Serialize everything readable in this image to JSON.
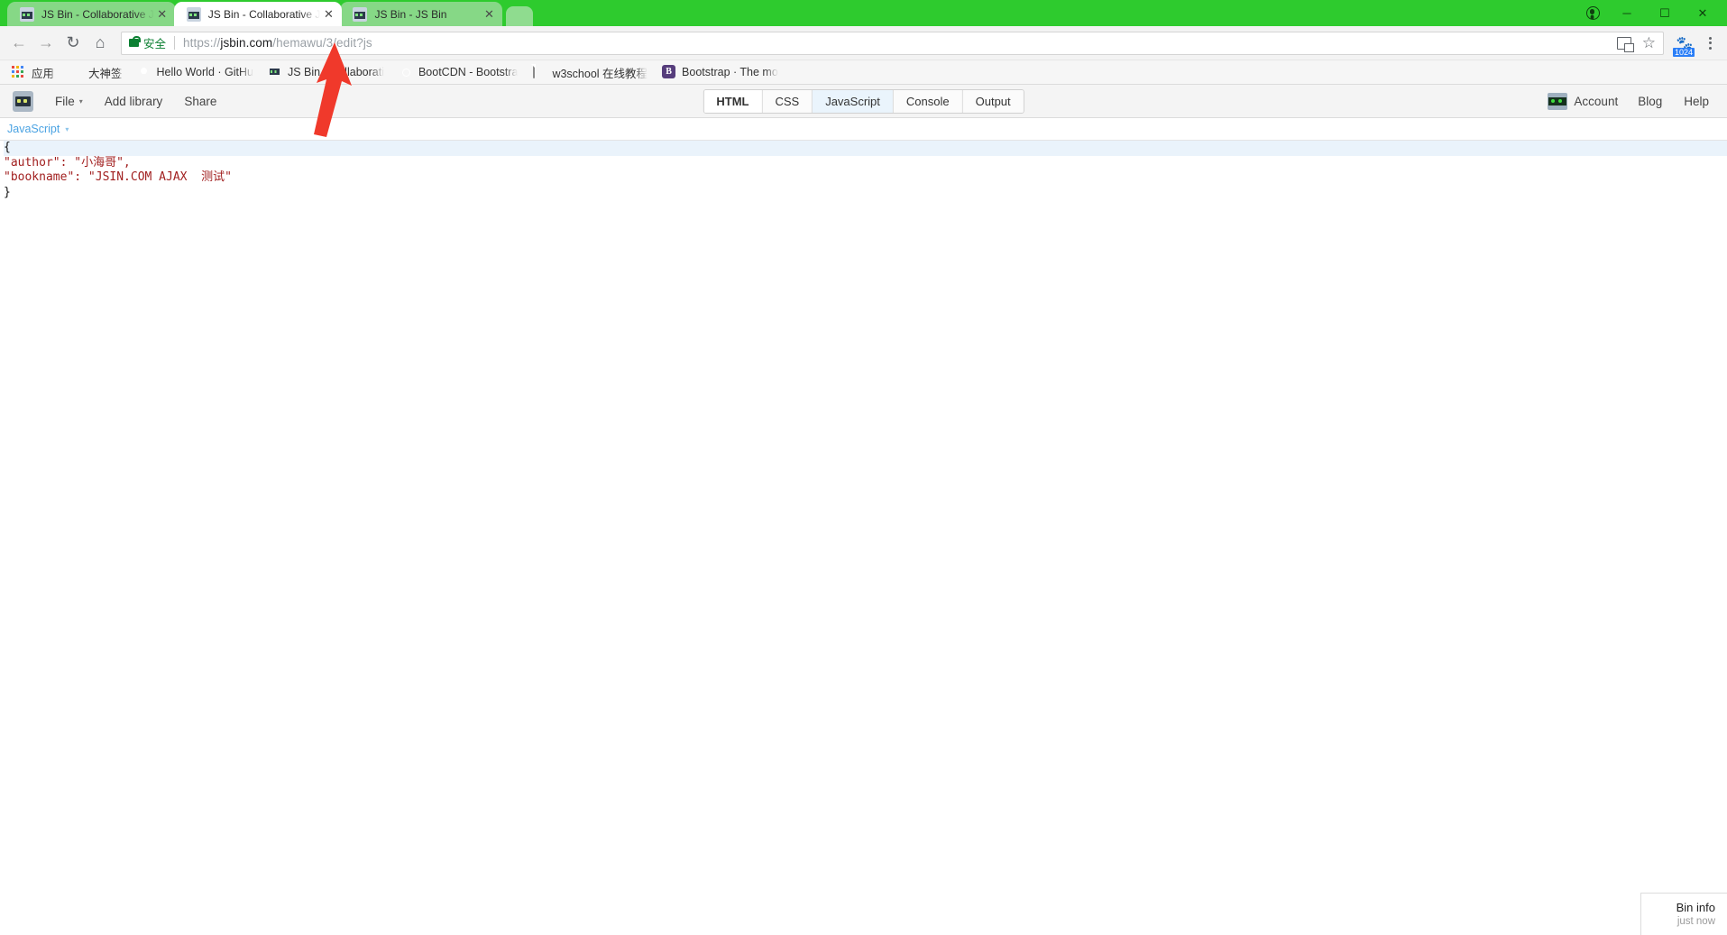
{
  "browser": {
    "tabs": [
      {
        "title": "JS Bin - Collaborative J",
        "active": false,
        "favicon": "jsbin-favicon"
      },
      {
        "title": "JS Bin - Collaborative J",
        "active": true,
        "favicon": "jsbin-favicon"
      },
      {
        "title": "JS Bin - JS Bin",
        "active": false,
        "favicon": "jsbin-favicon"
      }
    ],
    "window_controls": {
      "minimize": "—",
      "maximize": "❐",
      "close": "✕",
      "profile": "profile-icon"
    },
    "nav": {
      "back": "←",
      "forward": "→",
      "reload": "↻",
      "home": "⌂"
    },
    "omnibox": {
      "secure_label": "安全",
      "url_scheme": "https://",
      "url_host": "jsbin.com",
      "url_path": "/hemawu/3/edit?js",
      "url_full": "https://jsbin.com/hemawu/3/edit?js"
    },
    "omnibox_icons": {
      "translate": "translate-icon",
      "bookmark_star": "☆"
    },
    "extension": {
      "icon": "extension-icon",
      "badge": "1024"
    },
    "menu": "chrome-menu-icon",
    "bookmarks": [
      {
        "label": "应用",
        "icon": "apps-grid-icon"
      },
      {
        "label": "大神签",
        "icon": "folder-icon"
      },
      {
        "label": "Hello World · GitHu",
        "icon": "github-icon"
      },
      {
        "label": "JS Bin - Collaborati",
        "icon": "jsbin-icon"
      },
      {
        "label": "BootCDN - Bootstra",
        "icon": "bootcdn-icon"
      },
      {
        "label": "w3school 在线教程",
        "icon": "page-icon"
      },
      {
        "label": "Bootstrap · The mo",
        "icon": "bootstrap-icon"
      }
    ]
  },
  "jsbin": {
    "logo": "jsbin-logo-icon",
    "menu": [
      {
        "label": "File",
        "caret": "▾"
      },
      {
        "label": "Add library",
        "caret": ""
      },
      {
        "label": "Share",
        "caret": ""
      }
    ],
    "panel_tabs": [
      {
        "label": "HTML",
        "state": "bold"
      },
      {
        "label": "CSS",
        "state": "normal"
      },
      {
        "label": "JavaScript",
        "state": "selected"
      },
      {
        "label": "Console",
        "state": "normal"
      },
      {
        "label": "Output",
        "state": "normal"
      }
    ],
    "account": {
      "icon": "jsbin-account-icon",
      "label": "Account"
    },
    "right_links": [
      "Blog",
      "Help"
    ],
    "language_selector": {
      "label": "JavaScript",
      "caret": "▾"
    },
    "code_lines": [
      {
        "text": "{",
        "current": true
      },
      {
        "text": "\"author\": \"小海哥\",",
        "current": false
      },
      {
        "text": "\"bookname\": \"JSIN.COM AJAX  测试\"",
        "current": false
      },
      {
        "text": "}",
        "current": false
      }
    ],
    "bin_info": {
      "title": "Bin info",
      "subtitle": "just now"
    }
  },
  "annotation": {
    "type": "red-arrow",
    "color": "#f0392b",
    "points_at": "/3/"
  },
  "colors": {
    "theme_green": "#2ecb2e",
    "tab_inactive": "#86d886",
    "secure_green": "#0b7f32",
    "string_red": "#a11f1f",
    "link_blue": "#4ba3e3",
    "badge_blue": "#2a7ef7",
    "selected_tab_bg": "#eaf4fc"
  }
}
